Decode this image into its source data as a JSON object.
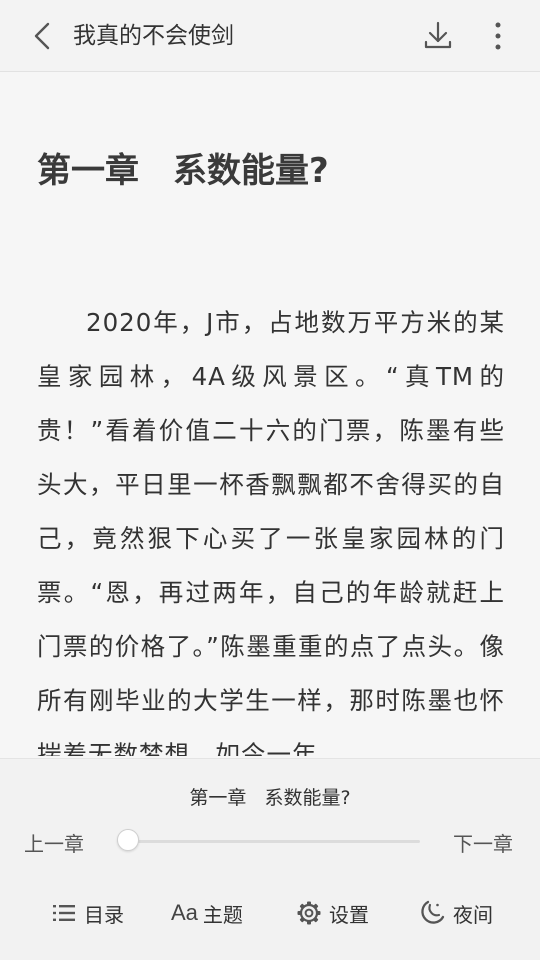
{
  "header": {
    "title": "我真的不会使剑"
  },
  "chapter": {
    "title": "第一章　系数能量?",
    "body": "2020年，J市，占地数万平方米的某皇家园林，4A级风景区。“真TM的贵！”看着价值二十六的门票，陈墨有些头大，平日里一杯香飘飘都不舍得买的自己，竟然狠下心买了一张皇家园林的门票。“恩，再过两年，自己的年龄就赶上门票的价格了。”陈墨重重的点了点头。像所有刚毕业的大学生一样，那时陈墨也怀揣着无数梦想，如今一年"
  },
  "bottom_panel": {
    "chapter_title": "第一章   系数能量?",
    "prev_label": "上一章",
    "next_label": "下一章",
    "progress_fraction": 0.0,
    "menu": [
      {
        "label": "目录",
        "icon": "list-icon"
      },
      {
        "label": "主题",
        "icon": "font-icon",
        "glyph": "Aa"
      },
      {
        "label": "设置",
        "icon": "gear-icon"
      },
      {
        "label": "夜间",
        "icon": "moon-icon"
      }
    ]
  },
  "colors": {
    "background": "#f6f6f6",
    "panel": "#f2f2f2",
    "text": "#333333",
    "icon": "#555555"
  }
}
